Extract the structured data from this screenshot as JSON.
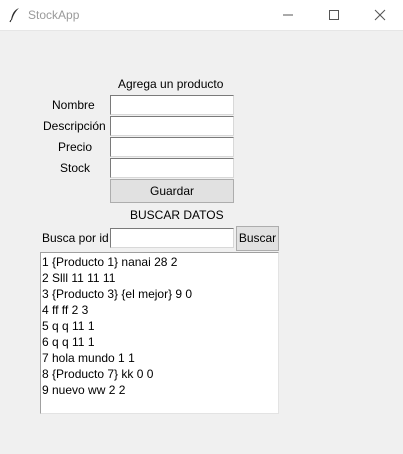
{
  "window": {
    "title": "StockApp",
    "minimize_icon": "minimize-icon",
    "maximize_icon": "maximize-icon",
    "close_icon": "close-icon"
  },
  "form": {
    "heading": "Agrega un producto",
    "name_label": "Nombre",
    "name_value": "",
    "description_label": "Descripción",
    "description_value": "",
    "price_label": "Precio",
    "price_value": "",
    "stock_label": "Stock",
    "stock_value": "",
    "save_label": "Guardar"
  },
  "search": {
    "heading": "BUSCAR DATOS",
    "label": "Busca por id",
    "value": "",
    "button_label": "Buscar"
  },
  "results": [
    "1 {Producto 1} nanai 28 2",
    "2 Slll 11 11 11",
    "3 {Producto 3} {el mejor} 9 0",
    "4 ff ff 2 3",
    "5 q q 11 1",
    "6 q q 11 1",
    "7 hola mundo 1 1",
    "8 {Producto 7} kk 0 0",
    "9 nuevo ww 2 2"
  ]
}
